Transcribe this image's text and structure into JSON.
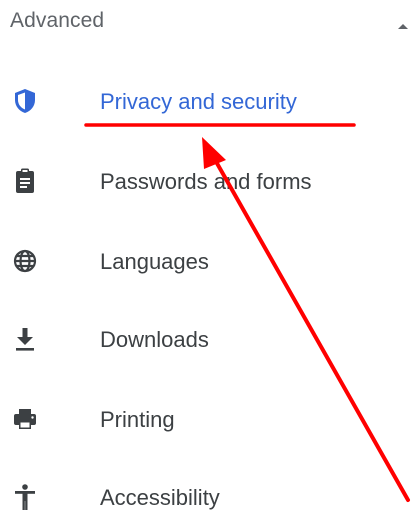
{
  "section": {
    "title": "Advanced",
    "collapse_icon": "chevron-up-icon"
  },
  "menu_items": [
    {
      "label": "Privacy and security",
      "icon": "shield-icon",
      "active": true
    },
    {
      "label": "Passwords and forms",
      "icon": "clipboard-icon",
      "active": false
    },
    {
      "label": "Languages",
      "icon": "globe-icon",
      "active": false
    },
    {
      "label": "Downloads",
      "icon": "download-icon",
      "active": false
    },
    {
      "label": "Printing",
      "icon": "printer-icon",
      "active": false
    },
    {
      "label": "Accessibility",
      "icon": "accessibility-icon",
      "active": false
    }
  ],
  "colors": {
    "active_text": "#3367d6",
    "default_text": "#3c4043",
    "icon_default": "#3c4043",
    "icon_active": "#3367d6",
    "annotation": "#ff0000"
  }
}
